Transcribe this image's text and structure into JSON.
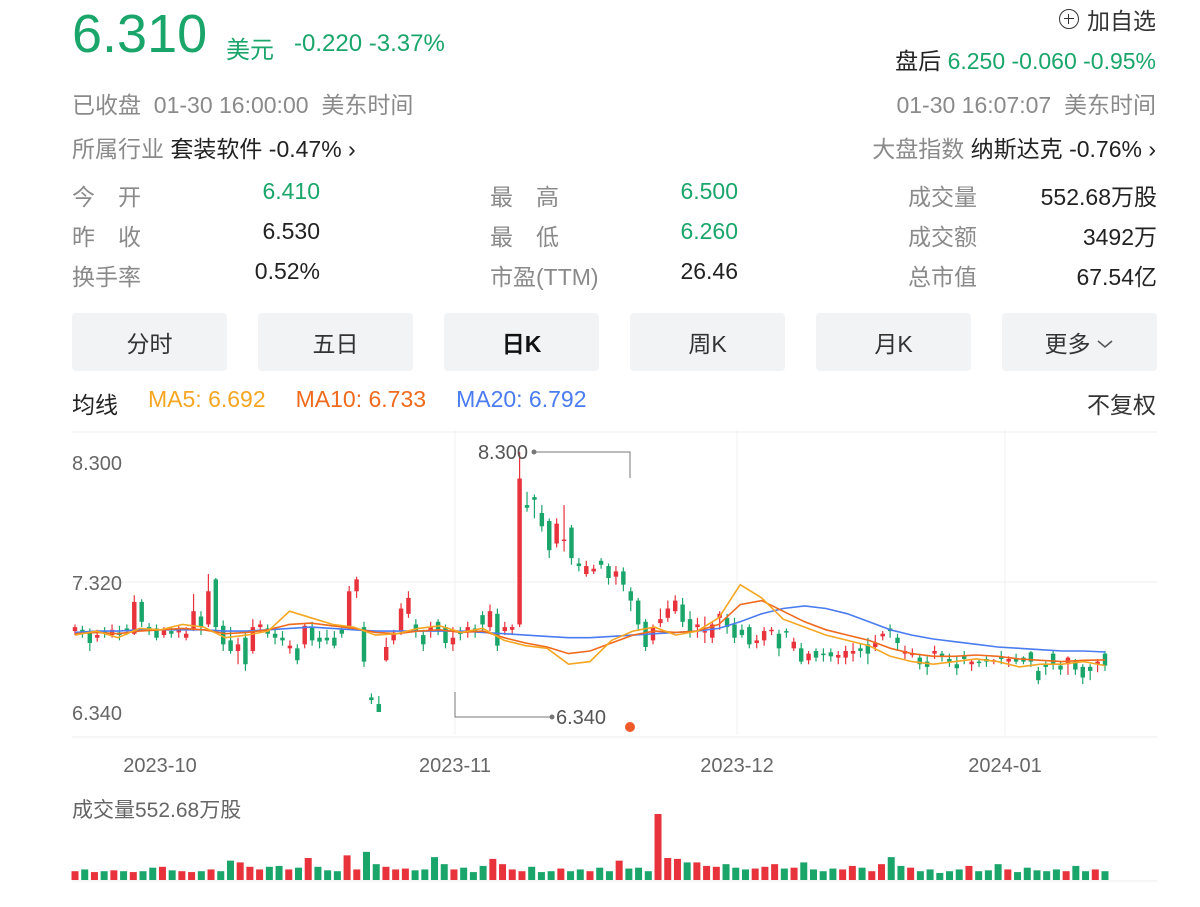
{
  "quote": {
    "price": "6.310",
    "currency": "美元",
    "change": "-0.220",
    "change_pct": "-3.37%",
    "watch_label": "加自选",
    "after_label": "盘后",
    "after_price": "6.250",
    "after_change": "-0.060",
    "after_change_pct": "-0.95%",
    "status": "已收盘",
    "close_time": "01-30 16:00:00",
    "timezone": "美东时间",
    "after_time": "01-30 16:07:07",
    "industry_label": "所属行业",
    "industry_name": "套装软件",
    "industry_change": "-0.47%",
    "index_label": "大盘指数",
    "index_name": "纳斯达克",
    "index_change": "-0.76%"
  },
  "stats": [
    {
      "label": "今　开",
      "value": "6.410",
      "color": "#1aa56a"
    },
    {
      "label": "最　高",
      "value": "6.500",
      "color": "#1aa56a"
    },
    {
      "label": "成交量",
      "value": "552.68万股",
      "color": "#222222"
    },
    {
      "label": "昨　收",
      "value": "6.530",
      "color": "#222222"
    },
    {
      "label": "最　低",
      "value": "6.260",
      "color": "#1aa56a"
    },
    {
      "label": "成交额",
      "value": "3492万",
      "color": "#222222"
    },
    {
      "label": "换手率",
      "value": "0.52%",
      "color": "#222222"
    },
    {
      "label": "市盈(TTM)",
      "value": "26.46",
      "color": "#222222"
    },
    {
      "label": "总市值",
      "value": "67.54亿",
      "color": "#222222"
    }
  ],
  "tabs": [
    "分时",
    "五日",
    "日K",
    "周K",
    "月K",
    "更多"
  ],
  "active_tab": 2,
  "ma": {
    "label": "均线",
    "ma5": "MA5: 6.692",
    "ma10": "MA10: 6.733",
    "ma20": "MA20: 6.792",
    "fuquan": "不复权",
    "colors": {
      "ma5": "#f5a623",
      "ma10": "#f06a1d",
      "ma20": "#4a7cf0"
    }
  },
  "colors": {
    "up": "#e8323c",
    "down": "#1aa56a",
    "grid": "#eeeeee"
  },
  "chart_data": {
    "type": "candlestick",
    "y_ticks": [
      "8.300",
      "7.320",
      "6.340"
    ],
    "x_ticks": [
      "2023-10",
      "2023-11",
      "2023-12",
      "2024-01"
    ],
    "annotations": {
      "max": "8.300",
      "min": "6.340"
    },
    "volume_label": "成交量552.68万股",
    "candles": [
      [
        6.95,
        6.98,
        6.92,
        7.0
      ],
      [
        6.96,
        6.93,
        6.9,
        6.99
      ],
      [
        6.95,
        6.86,
        6.8,
        6.97
      ],
      [
        6.9,
        6.92,
        6.87,
        6.96
      ],
      [
        6.95,
        6.93,
        6.9,
        6.98
      ],
      [
        6.92,
        6.96,
        6.9,
        7.0
      ],
      [
        6.94,
        6.92,
        6.88,
        6.99
      ],
      [
        6.97,
        6.95,
        6.92,
        7.0
      ],
      [
        6.93,
        7.17,
        6.92,
        7.22
      ],
      [
        7.17,
        7.02,
        6.98,
        7.19
      ],
      [
        6.98,
        6.95,
        6.92,
        7.01
      ],
      [
        6.97,
        6.9,
        6.88,
        7.0
      ],
      [
        6.92,
        6.96,
        6.9,
        6.98
      ],
      [
        6.95,
        6.93,
        6.9,
        6.98
      ],
      [
        6.94,
        6.96,
        6.9,
        6.99
      ],
      [
        6.9,
        6.93,
        6.88,
        6.98
      ],
      [
        6.97,
        7.1,
        6.95,
        7.23
      ],
      [
        7.06,
        6.98,
        6.92,
        7.1
      ],
      [
        7.0,
        7.25,
        6.98,
        7.38
      ],
      [
        7.34,
        6.98,
        6.94,
        7.35
      ],
      [
        6.99,
        6.85,
        6.8,
        7.03
      ],
      [
        6.88,
        6.8,
        6.78,
        6.98
      ],
      [
        6.8,
        6.85,
        6.7,
        6.9
      ],
      [
        6.9,
        6.7,
        6.65,
        6.95
      ],
      [
        6.8,
        6.98,
        6.78,
        7.04
      ],
      [
        6.98,
        7.0,
        6.94,
        7.03
      ],
      [
        6.97,
        6.93,
        6.9,
        7.0
      ],
      [
        6.93,
        6.9,
        6.85,
        6.98
      ],
      [
        6.9,
        6.88,
        6.84,
        6.95
      ],
      [
        6.82,
        6.84,
        6.78,
        6.88
      ],
      [
        6.82,
        6.73,
        6.7,
        6.85
      ],
      [
        6.85,
        6.99,
        6.82,
        7.01
      ],
      [
        6.98,
        6.88,
        6.84,
        7.02
      ],
      [
        6.9,
        6.87,
        6.82,
        6.95
      ],
      [
        6.9,
        6.88,
        6.85,
        6.96
      ],
      [
        6.9,
        6.84,
        6.82,
        6.95
      ],
      [
        6.96,
        6.93,
        6.9,
        6.99
      ],
      [
        6.98,
        7.25,
        6.96,
        7.29
      ],
      [
        7.25,
        7.34,
        7.2,
        7.36
      ],
      [
        6.98,
        6.72,
        6.68,
        7.02
      ],
      [
        6.45,
        6.43,
        6.4,
        6.48
      ],
      [
        6.4,
        6.34,
        6.34,
        6.46
      ],
      [
        6.73,
        6.83,
        6.72,
        6.9
      ],
      [
        6.88,
        6.94,
        6.85,
        6.96
      ],
      [
        6.95,
        7.12,
        6.92,
        7.16
      ],
      [
        7.08,
        7.2,
        7.05,
        7.25
      ],
      [
        7.0,
        6.95,
        6.9,
        7.04
      ],
      [
        6.92,
        6.85,
        6.8,
        6.96
      ],
      [
        6.95,
        6.98,
        6.9,
        7.02
      ],
      [
        7.02,
        6.96,
        6.92,
        7.04
      ],
      [
        6.98,
        6.86,
        6.82,
        7.0
      ],
      [
        6.85,
        6.9,
        6.8,
        6.98
      ],
      [
        6.94,
        6.93,
        6.88,
        6.98
      ],
      [
        6.95,
        6.98,
        6.9,
        7.02
      ],
      [
        6.97,
        6.95,
        6.9,
        7.0
      ],
      [
        7.07,
        7.0,
        6.95,
        7.1
      ],
      [
        6.98,
        7.1,
        6.95,
        7.15
      ],
      [
        7.08,
        6.84,
        6.8,
        7.12
      ],
      [
        6.95,
        6.98,
        6.92,
        7.02
      ],
      [
        6.96,
        6.98,
        6.92,
        7.0
      ],
      [
        7.0,
        8.1,
        6.98,
        8.3
      ],
      [
        7.9,
        7.88,
        7.85,
        8.0
      ],
      [
        7.96,
        7.94,
        7.8,
        7.98
      ],
      [
        7.84,
        7.74,
        7.7,
        7.9
      ],
      [
        7.78,
        7.56,
        7.5,
        7.8
      ],
      [
        7.61,
        7.76,
        7.58,
        7.8
      ],
      [
        7.63,
        7.64,
        7.55,
        7.9
      ],
      [
        7.73,
        7.5,
        7.45,
        7.75
      ],
      [
        7.46,
        7.44,
        7.4,
        7.5
      ],
      [
        7.38,
        7.44,
        7.36,
        7.48
      ],
      [
        7.4,
        7.42,
        7.38,
        7.45
      ],
      [
        7.48,
        7.45,
        7.42,
        7.5
      ],
      [
        7.44,
        7.35,
        7.3,
        7.46
      ],
      [
        7.36,
        7.4,
        7.3,
        7.44
      ],
      [
        7.4,
        7.3,
        7.25,
        7.43
      ],
      [
        7.25,
        7.18,
        7.1,
        7.28
      ],
      [
        7.18,
        7.0,
        6.95,
        7.2
      ],
      [
        7.02,
        6.83,
        6.8,
        7.04
      ],
      [
        6.88,
        6.98,
        6.85,
        7.0
      ],
      [
        7.01,
        7.04,
        6.98,
        7.12
      ],
      [
        7.05,
        7.12,
        7.02,
        7.18
      ],
      [
        7.1,
        7.18,
        7.08,
        7.22
      ],
      [
        7.15,
        7.02,
        6.98,
        7.2
      ],
      [
        7.04,
        6.94,
        6.9,
        7.1
      ],
      [
        6.98,
        7.0,
        6.9,
        7.05
      ],
      [
        6.94,
        6.95,
        6.86,
        7.06
      ],
      [
        6.9,
        7.0,
        6.86,
        7.02
      ],
      [
        7.05,
        7.08,
        6.96,
        7.1
      ],
      [
        7.05,
        6.98,
        6.93,
        7.08
      ],
      [
        7.0,
        6.9,
        6.86,
        7.05
      ],
      [
        6.96,
        6.92,
        6.9,
        7.0
      ],
      [
        6.98,
        6.85,
        6.82,
        7.0
      ],
      [
        6.86,
        6.88,
        6.82,
        6.92
      ],
      [
        6.88,
        6.95,
        6.84,
        6.98
      ],
      [
        6.95,
        6.96,
        6.92,
        6.98
      ],
      [
        6.93,
        6.82,
        6.76,
        6.96
      ],
      [
        6.95,
        6.94,
        6.9,
        6.97
      ],
      [
        6.82,
        6.87,
        6.8,
        6.9
      ],
      [
        6.82,
        6.72,
        6.7,
        6.86
      ],
      [
        6.73,
        6.78,
        6.7,
        6.8
      ],
      [
        6.8,
        6.75,
        6.72,
        6.82
      ],
      [
        6.78,
        6.77,
        6.72,
        6.82
      ],
      [
        6.79,
        6.76,
        6.72,
        6.82
      ],
      [
        6.75,
        6.77,
        6.7,
        6.8
      ],
      [
        6.75,
        6.8,
        6.7,
        6.84
      ],
      [
        6.78,
        6.8,
        6.72,
        6.86
      ],
      [
        6.82,
        6.8,
        6.75,
        6.85
      ],
      [
        6.85,
        6.78,
        6.7,
        6.9
      ],
      [
        6.83,
        6.86,
        6.8,
        6.92
      ],
      [
        6.91,
        6.93,
        6.88,
        6.95
      ],
      [
        6.97,
        6.95,
        6.9,
        7.0
      ],
      [
        6.9,
        6.86,
        6.8,
        6.93
      ],
      [
        6.78,
        6.8,
        6.74,
        6.84
      ],
      [
        6.78,
        6.78,
        6.75,
        6.82
      ],
      [
        6.75,
        6.7,
        6.66,
        6.78
      ],
      [
        6.72,
        6.68,
        6.62,
        6.76
      ],
      [
        6.78,
        6.8,
        6.74,
        6.84
      ],
      [
        6.78,
        6.76,
        6.72,
        6.8
      ],
      [
        6.74,
        6.72,
        6.68,
        6.78
      ],
      [
        6.7,
        6.67,
        6.62,
        6.76
      ],
      [
        6.76,
        6.74,
        6.7,
        6.8
      ],
      [
        6.7,
        6.72,
        6.65,
        6.74
      ],
      [
        6.72,
        6.71,
        6.68,
        6.74
      ],
      [
        6.74,
        6.72,
        6.68,
        6.76
      ],
      [
        6.72,
        6.73,
        6.7,
        6.74
      ],
      [
        6.76,
        6.74,
        6.7,
        6.8
      ],
      [
        6.72,
        6.74,
        6.68,
        6.76
      ],
      [
        6.74,
        6.72,
        6.7,
        6.78
      ],
      [
        6.75,
        6.72,
        6.7,
        6.76
      ],
      [
        6.79,
        6.72,
        6.68,
        6.8
      ],
      [
        6.65,
        6.58,
        6.55,
        6.68
      ],
      [
        6.7,
        6.68,
        6.62,
        6.72
      ],
      [
        6.78,
        6.7,
        6.66,
        6.8
      ],
      [
        6.69,
        6.66,
        6.62,
        6.72
      ],
      [
        6.7,
        6.75,
        6.62,
        6.76
      ],
      [
        6.72,
        6.66,
        6.62,
        6.74
      ],
      [
        6.68,
        6.6,
        6.55,
        6.7
      ],
      [
        6.68,
        6.65,
        6.58,
        6.7
      ],
      [
        6.7,
        6.72,
        6.64,
        6.74
      ],
      [
        6.78,
        6.69,
        6.65,
        6.8
      ]
    ],
    "ma5_points": [
      6.92,
      6.95,
      6.9,
      6.97,
      6.96,
      7.0,
      6.98,
      6.9,
      6.92,
      6.95,
      7.1,
      7.05,
      7.0,
      6.98,
      6.92,
      6.93,
      6.97,
      6.99,
      6.94,
      6.97,
      6.88,
      6.84,
      6.82,
      6.7,
      6.72,
      6.88,
      6.95,
      6.98,
      6.92,
      6.95,
      7.05,
      7.3,
      7.2,
      7.04,
      6.98,
      6.92,
      6.88,
      6.84,
      6.76,
      6.72,
      6.7,
      6.72,
      6.74,
      6.72,
      6.68,
      6.7,
      6.7,
      6.72,
      6.69
    ],
    "ma10_points": [
      6.93,
      6.94,
      6.93,
      6.95,
      6.96,
      6.97,
      6.96,
      6.93,
      6.94,
      6.96,
      7.0,
      7.01,
      6.99,
      6.97,
      6.94,
      6.93,
      6.95,
      6.96,
      6.94,
      6.95,
      6.9,
      6.86,
      6.83,
      6.78,
      6.8,
      6.86,
      6.92,
      6.95,
      6.94,
      6.95,
      7.0,
      7.15,
      7.18,
      7.1,
      7.02,
      6.96,
      6.92,
      6.88,
      6.82,
      6.78,
      6.76,
      6.76,
      6.77,
      6.76,
      6.74,
      6.73,
      6.72,
      6.73,
      6.733
    ],
    "ma20_points": [
      6.94,
      6.95,
      6.95,
      6.96,
      6.96,
      6.96,
      6.96,
      6.95,
      6.95,
      6.96,
      6.97,
      6.98,
      6.97,
      6.96,
      6.95,
      6.95,
      6.95,
      6.95,
      6.95,
      6.94,
      6.93,
      6.92,
      6.91,
      6.9,
      6.9,
      6.91,
      6.92,
      6.93,
      6.94,
      6.95,
      6.97,
      7.02,
      7.08,
      7.12,
      7.14,
      7.12,
      7.08,
      7.02,
      6.96,
      6.92,
      6.89,
      6.87,
      6.85,
      6.83,
      6.82,
      6.81,
      6.8,
      6.8,
      6.792
    ],
    "volumes": [
      1.0,
      1.2,
      0.9,
      1.0,
      1.1,
      1.0,
      0.9,
      1.0,
      1.4,
      1.5,
      1.1,
      1.0,
      0.9,
      1.0,
      1.2,
      1.0,
      2.2,
      2.0,
      1.5,
      1.2,
      1.5,
      1.6,
      1.2,
      1.4,
      2.5,
      1.5,
      1.1,
      1.0,
      2.8,
      1.2,
      3.2,
      1.8,
      1.5,
      1.2,
      1.3,
      1.1,
      1.2,
      2.6,
      1.8,
      1.2,
      1.4,
      0.9,
      1.6,
      2.4,
      1.8,
      1.2,
      1.0,
      1.5,
      0.9,
      1.0,
      1.3,
      1.0,
      1.2,
      1.0,
      1.4,
      1.0,
      2.2,
      1.3,
      1.4,
      1.0,
      7.5,
      2.5,
      2.4,
      2.0,
      2.0,
      1.6,
      1.5,
      1.8,
      1.4,
      1.2,
      1.3,
      1.5,
      1.8,
      1.3,
      1.4,
      2.0,
      1.2,
      1.0,
      1.3,
      1.2,
      1.6,
      1.4,
      1.0,
      1.8,
      2.6,
      1.6,
      1.4,
      1.0,
      1.2,
      0.8,
      1.0,
      1.2,
      1.6,
      1.0,
      1.1,
      1.8,
      1.2,
      0.9,
      1.4,
      1.1,
      1.0,
      1.2,
      1.0,
      1.6,
      1.0,
      1.2,
      1.0
    ]
  }
}
